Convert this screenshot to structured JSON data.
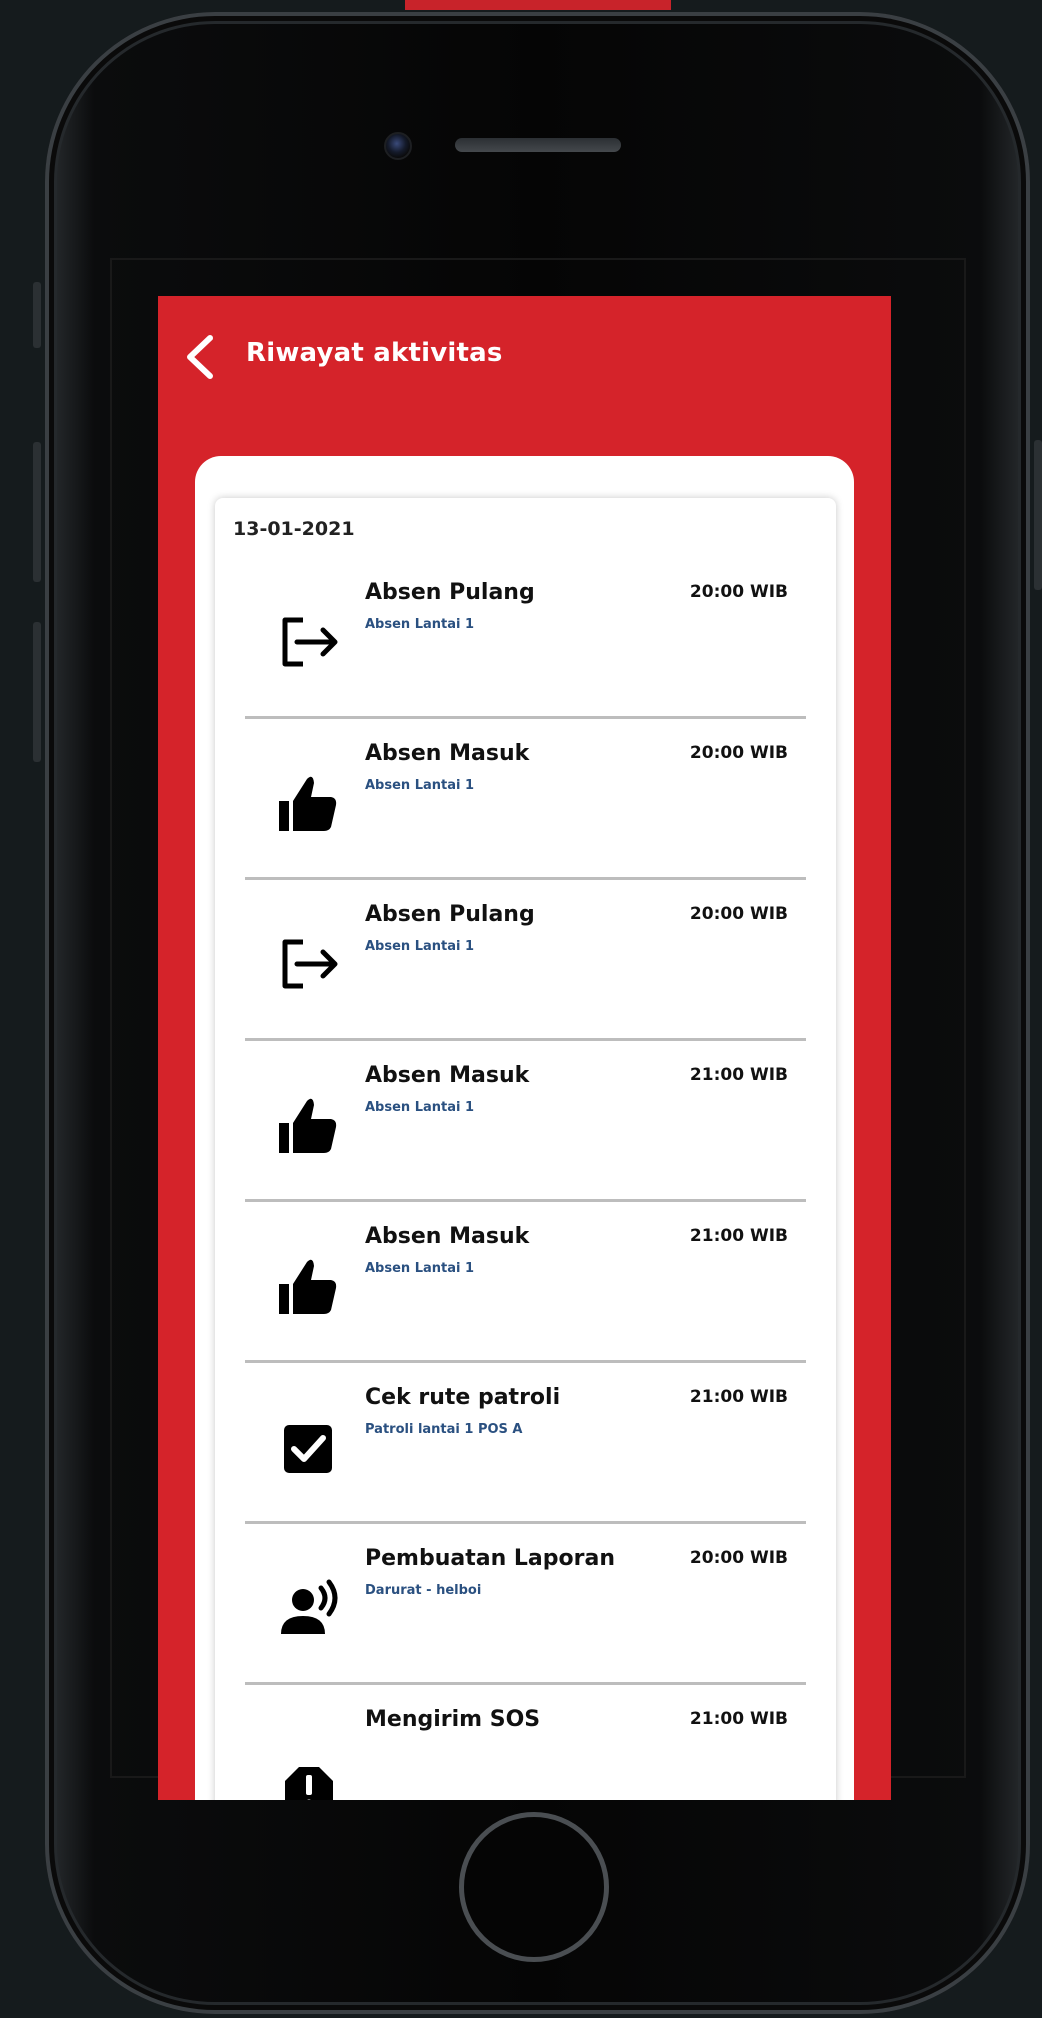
{
  "colors": {
    "header": "#d5232a",
    "subtitle": "#2a5080"
  },
  "header": {
    "title": "Riwayat aktivitas",
    "back_icon": "chevron-left-icon"
  },
  "date": "13-01-2021",
  "activities": [
    {
      "title": "Absen Pulang",
      "subtitle": "Absen Lantai 1",
      "time": "20:00 WIB",
      "icon": "logout-icon"
    },
    {
      "title": "Absen Masuk",
      "subtitle": "Absen Lantai 1",
      "time": "20:00 WIB",
      "icon": "thumbs-up-icon"
    },
    {
      "title": "Absen Pulang",
      "subtitle": "Absen Lantai 1",
      "time": "20:00 WIB",
      "icon": "logout-icon"
    },
    {
      "title": "Absen Masuk",
      "subtitle": "Absen Lantai 1",
      "time": "21:00 WIB",
      "icon": "thumbs-up-icon"
    },
    {
      "title": "Absen Masuk",
      "subtitle": "Absen Lantai 1",
      "time": "21:00 WIB",
      "icon": "thumbs-up-icon"
    },
    {
      "title": "Cek rute patroli",
      "subtitle": "Patroli lantai 1 POS A",
      "time": "21:00 WIB",
      "icon": "checkbox-checked-icon"
    },
    {
      "title": "Pembuatan Laporan",
      "subtitle": "Darurat - helboi",
      "time": "20:00 WIB",
      "icon": "speaking-person-icon"
    },
    {
      "title": "Mengirim SOS",
      "subtitle": "",
      "time": "21:00 WIB",
      "icon": "alert-octagon-icon"
    }
  ]
}
